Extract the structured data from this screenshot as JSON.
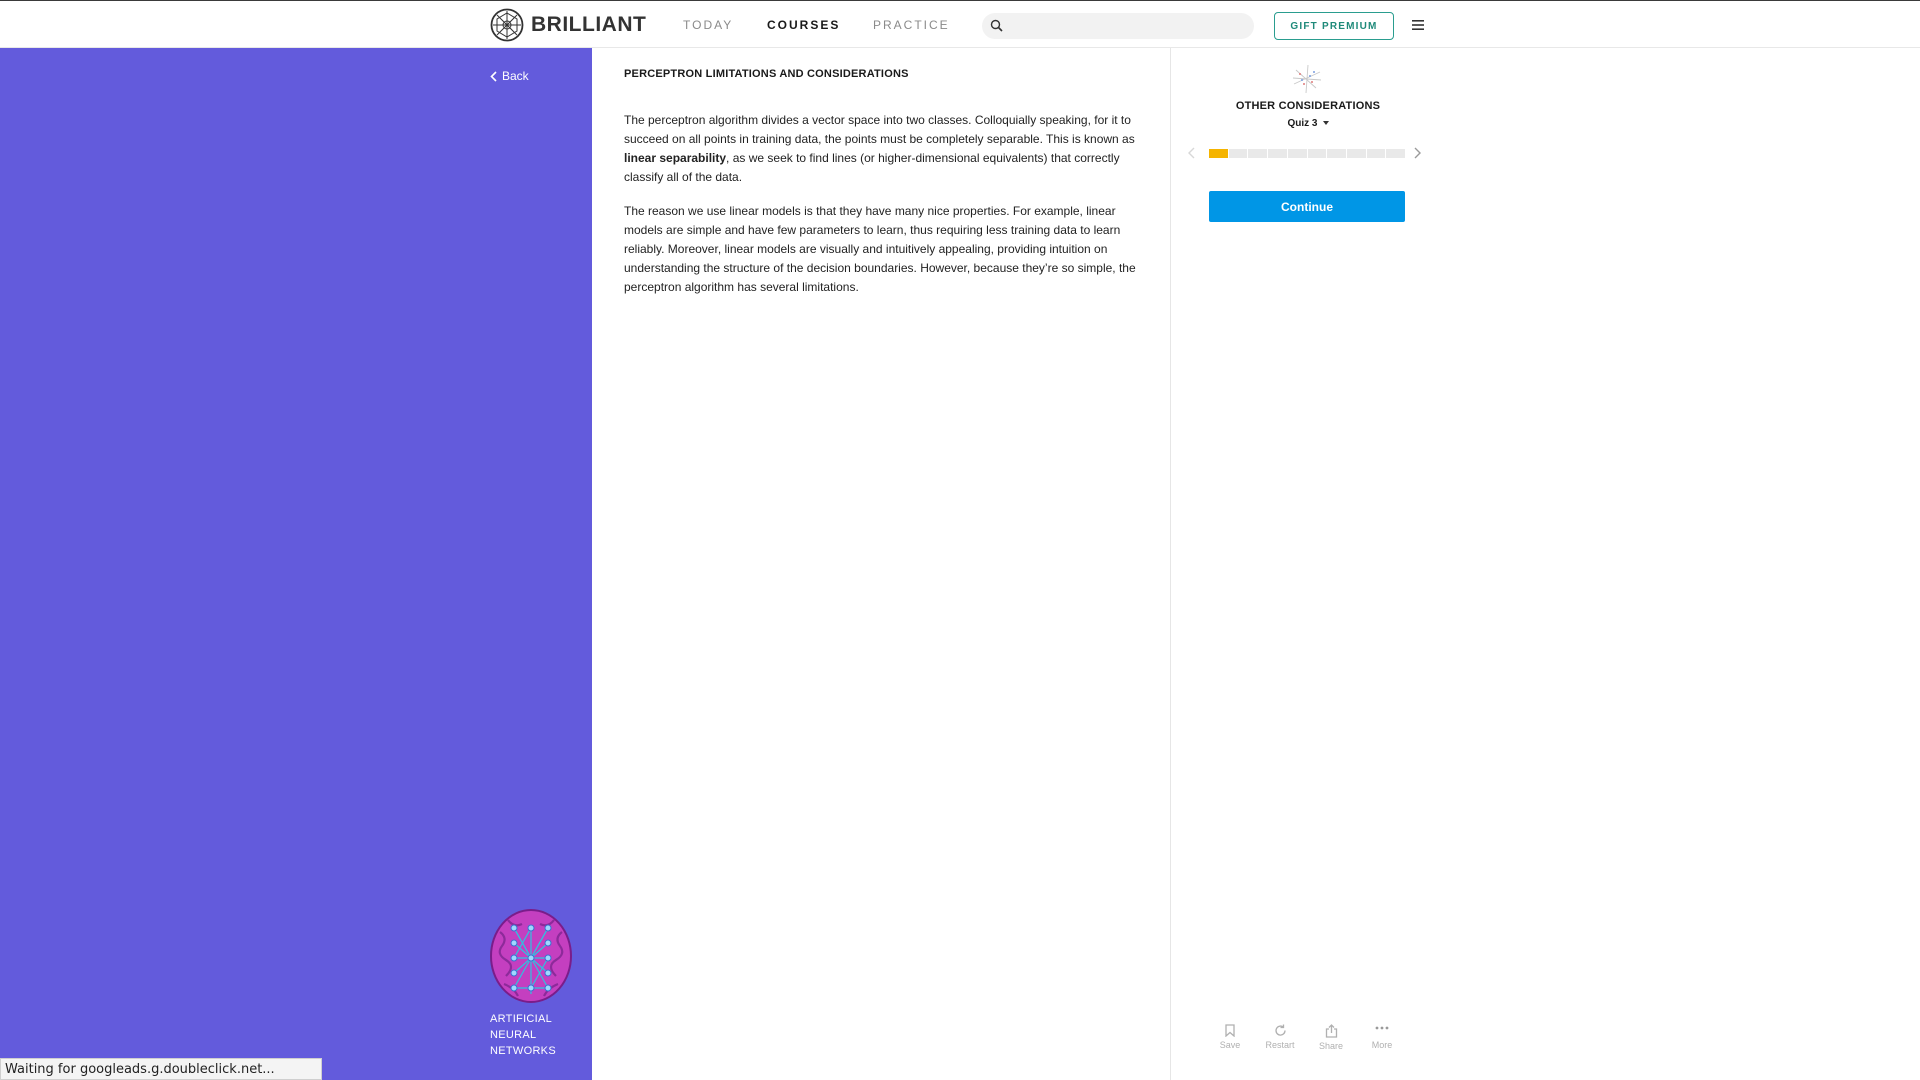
{
  "header": {
    "brand": "BRILLIANT",
    "nav": [
      {
        "label": "TODAY",
        "active": false
      },
      {
        "label": "COURSES",
        "active": true
      },
      {
        "label": "PRACTICE",
        "active": false
      }
    ],
    "search": {
      "value": "",
      "placeholder": ""
    },
    "gift_label": "GIFT PREMIUM",
    "menu_icon": "hamburger-icon"
  },
  "sidebar": {
    "back_label": "Back",
    "course_title_lines": [
      "ARTIFICIAL",
      "NEURAL",
      "NETWORKS"
    ],
    "background_color": "#635bdc"
  },
  "content": {
    "chapter_title": "PERCEPTRON LIMITATIONS AND CONSIDERATIONS",
    "p1_before": "The perceptron algorithm divides a vector space into two classes. Colloquially speaking, for it to succeed on all points in training data, the points must be completely separable. This is known as ",
    "p1_bold": "linear separability",
    "p1_after": ", as we seek to find lines (or higher-dimensional equivalents) that correctly classify all of the data.",
    "p2": "The reason we use linear models is that they have many nice properties. For example, linear models are simple and have few parameters to learn, thus requiring less training data to learn reliably. Moreover, linear models are visually and intuitively appealing, providing intuition on understanding the structure of the decision boundaries. However, because they’re so simple, the perceptron algorithm has several limitations."
  },
  "quiz": {
    "section_title": "OTHER CONSIDERATIONS",
    "quiz_name": "Quiz 3",
    "progress": {
      "total_segments": 10,
      "completed_segments": 1
    },
    "continue_label": "Continue",
    "accent_color": "#0096e6",
    "progress_color": "#f5b400",
    "actions": [
      {
        "label": "Save",
        "icon": "bookmark-icon"
      },
      {
        "label": "Restart",
        "icon": "restart-icon"
      },
      {
        "label": "Share",
        "icon": "share-icon"
      },
      {
        "label": "More",
        "icon": "more-icon"
      }
    ]
  },
  "status_bar": {
    "text": "Waiting for googleads.g.doubleclick.net..."
  }
}
